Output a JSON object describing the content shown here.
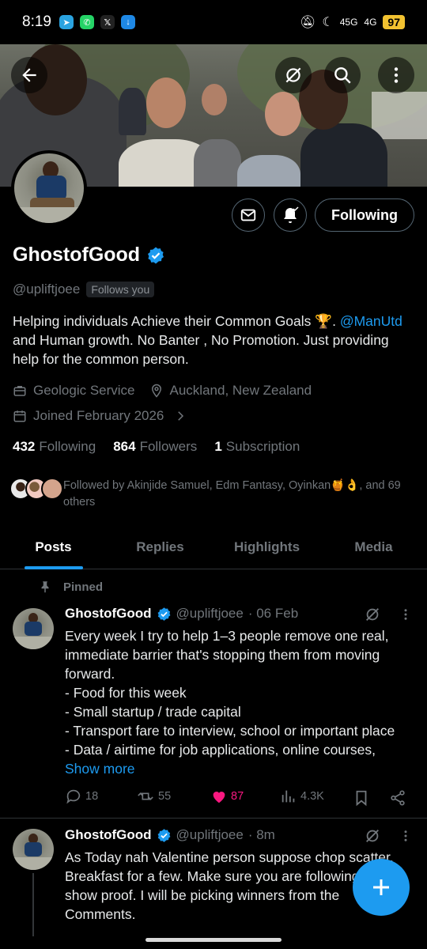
{
  "status_bar": {
    "time": "8:19",
    "network": "45G",
    "network2": "4G",
    "battery": "97"
  },
  "profile": {
    "name": "GhostofGood",
    "handle": "@upliftjoee",
    "follows_you": "Follows you",
    "follow_button": "Following",
    "bio_part1": "Helping individuals Achieve their Common Goals 🏆.",
    "bio_link": "@ManUtd",
    "bio_part2": " and Human growth. No Banter , No Promotion. Just providing help for the common person.",
    "category": "Geologic Service",
    "location": "Auckland, New Zealand",
    "joined": "Joined February 2026",
    "following_count": "432",
    "following_label": "Following",
    "followers_count": "864",
    "followers_label": "Followers",
    "subscription_count": "1",
    "subscription_label": "Subscription",
    "followed_by": "Followed by Akinjide Samuel, Edm Fantasy, Oyinkan🍯👌, and 69 others"
  },
  "tabs": [
    {
      "label": "Posts"
    },
    {
      "label": "Replies"
    },
    {
      "label": "Highlights"
    },
    {
      "label": "Media"
    }
  ],
  "tweets": [
    {
      "pinned_label": "Pinned",
      "name": "GhostofGood",
      "handle": "@upliftjoee",
      "date": "· 06 Feb",
      "lines": [
        "Every week I try to help 1–3 people remove one real, immediate barrier that's stopping them from moving forward.",
        "- Food for this week",
        "- Small startup / trade capital",
        "- Transport fare to interview, school or important place",
        "- Data / airtime for job applications, online courses,"
      ],
      "show_more": "Show more",
      "replies": "18",
      "retweets": "55",
      "likes": "87",
      "views": "4.3K"
    },
    {
      "name": "GhostofGood",
      "handle": "@upliftjoee",
      "date": "· 8m",
      "text": "As Today nah Valentine person suppose chop scatter. Breakfast for a few. Make sure you are following and show proof. I will be picking winners from the Comments."
    }
  ],
  "colors": {
    "accent": "#1d9bf0",
    "like": "#f91880",
    "muted": "#71767b",
    "battery": "#f2c230"
  }
}
